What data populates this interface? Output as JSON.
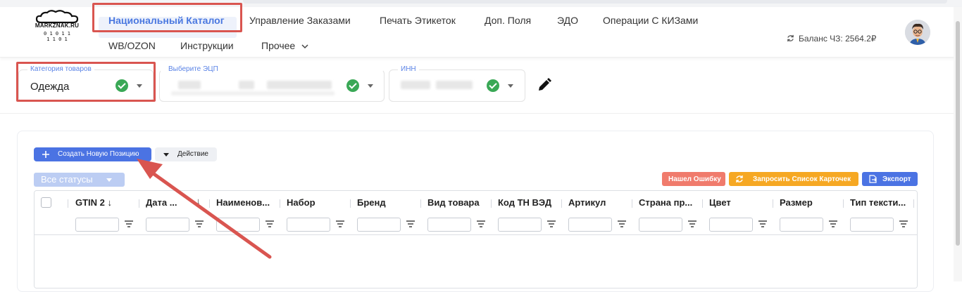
{
  "logo": {
    "name": "MARKZNAK.RU",
    "bits": "0 1 0 1 1\n1 1 0 1"
  },
  "nav": {
    "items": [
      "Национальный Каталог",
      "Управление Заказами",
      "Печать Этикеток",
      "Доп. Поля",
      "ЭДО",
      "Операции С КИЗами",
      "WB/OZON",
      "Инструкции",
      "Прочее"
    ],
    "active_index": 0
  },
  "balance": "Баланс ЧЗ: 2564.2₽",
  "filters": {
    "category": {
      "label": "Категория товаров",
      "value": "Одежда"
    },
    "signature": {
      "label": "Выберите ЭЦП"
    },
    "inn": {
      "label": "ИНН"
    }
  },
  "toolbar": {
    "create_label": "Создать Новую Позицию",
    "action_label": "Действие",
    "status_label": "Все статусы",
    "report_error_label": "Нашел Ошибку",
    "request_cards_label": "Запросить Список Карточек",
    "export_label": "Экспорт"
  },
  "table": {
    "columns": [
      "GTIN 2",
      "Дата ...",
      "Наименов...",
      "Набор",
      "Бренд",
      "Вид товара",
      "Код ТН ВЭД",
      "Артикул",
      "Страна пр...",
      "Цвет",
      "Размер",
      "Тип тексти..."
    ],
    "rows": []
  },
  "colors": {
    "accent": "#4b73e3",
    "annotation": "#d95550",
    "success": "#3aa856",
    "report_error": "#f07b6c",
    "request_cards": "#f6a823",
    "export": "#4b73e3"
  }
}
